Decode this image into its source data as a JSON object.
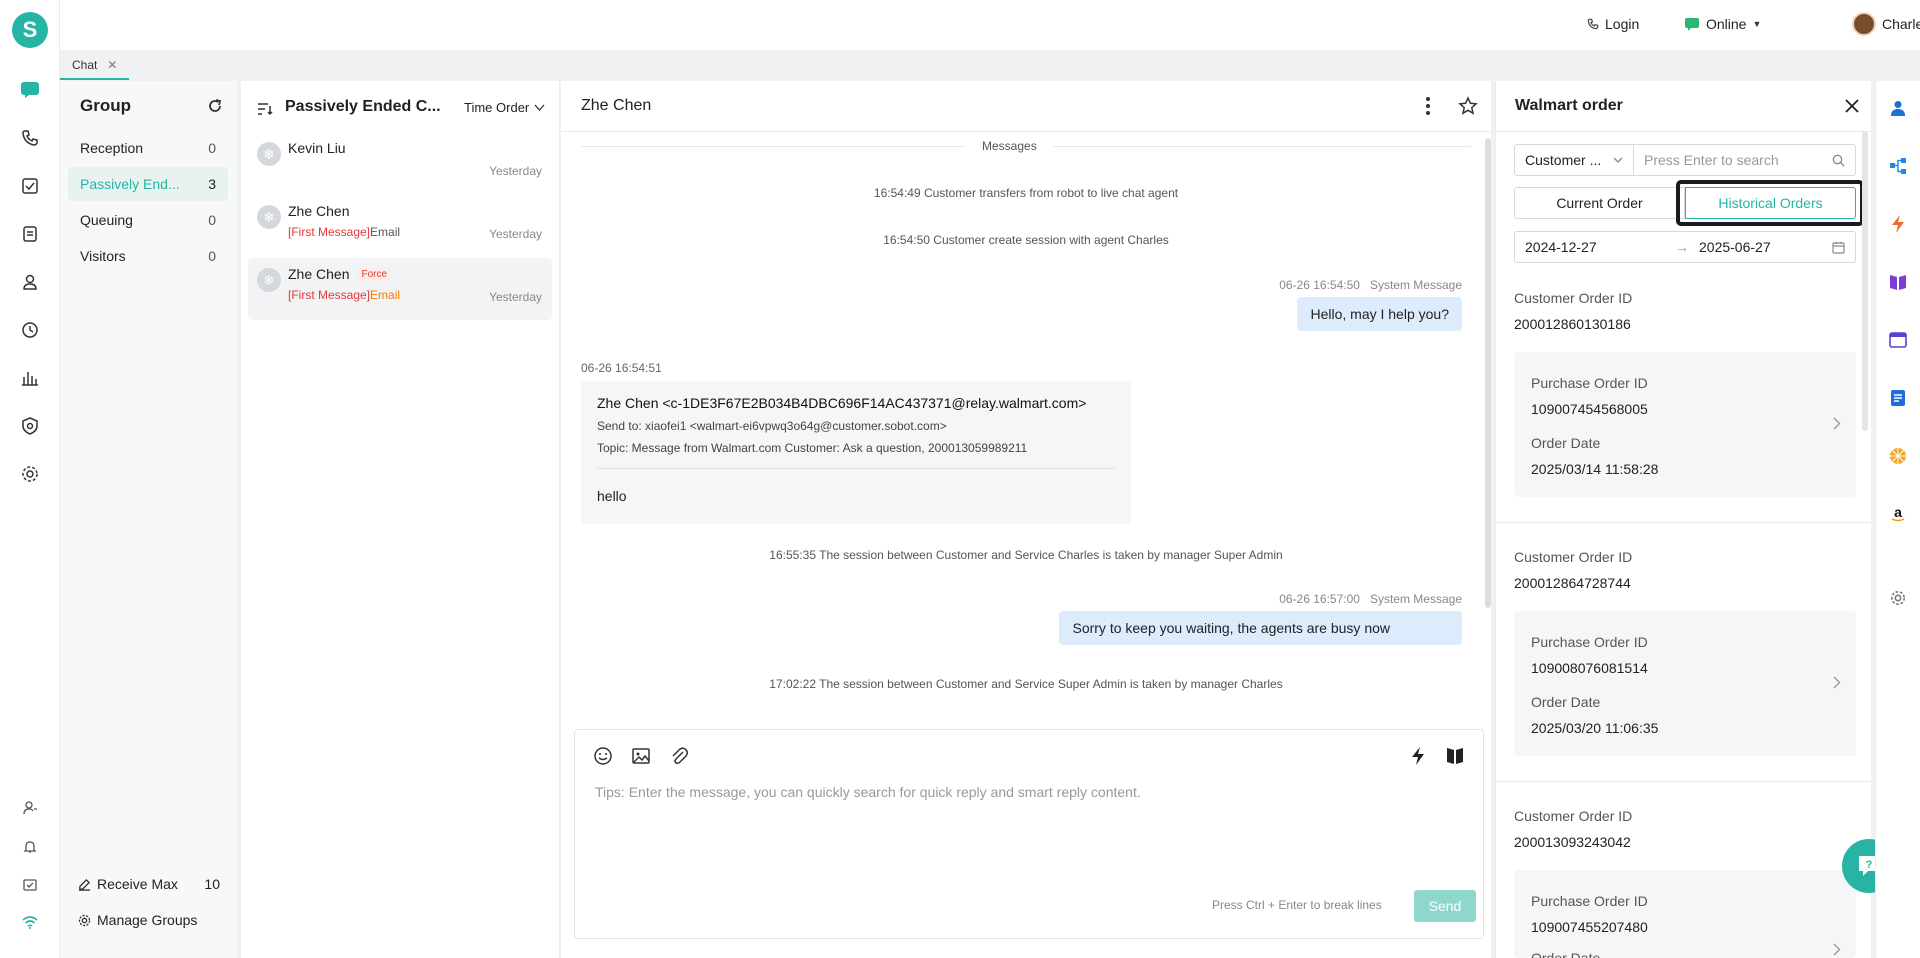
{
  "topbar": {
    "login": "Login",
    "status": "Online",
    "user": "Charles"
  },
  "tabs": [
    {
      "label": "Chat"
    }
  ],
  "groups": {
    "title": "Group",
    "items": [
      {
        "label": "Reception",
        "count": "0"
      },
      {
        "label": "Passively End...",
        "count": "3"
      },
      {
        "label": "Queuing",
        "count": "0"
      },
      {
        "label": "Visitors",
        "count": "0"
      }
    ],
    "receive_max_label": "Receive Max",
    "receive_max_value": "10",
    "manage_groups": "Manage Groups"
  },
  "list": {
    "title": "Passively Ended C...",
    "sort": "Time Order",
    "items": [
      {
        "name": "Kevin Liu",
        "tag": "",
        "preview_prefix": "",
        "preview_text": "",
        "time": "Yesterday"
      },
      {
        "name": "Zhe Chen",
        "tag": "",
        "preview_prefix": "[First Message]",
        "preview_text": "Email",
        "time": "Yesterday"
      },
      {
        "name": "Zhe Chen",
        "tag": "Force",
        "preview_prefix": "[First Message]",
        "preview_text": "Email",
        "time": "Yesterday"
      }
    ]
  },
  "chat": {
    "title": "Zhe Chen",
    "divider": "Messages",
    "sys1": "16:54:49 Customer transfers from robot to live chat agent",
    "sys2": "16:54:50 Customer create session with agent Charles",
    "msg1_time": "06-26 16:54:50",
    "msg1_sender": "System Message",
    "msg1_text": "Hello, may I help you?",
    "email_time": "06-26 16:54:51",
    "email_from": "Zhe Chen <c-1DE3F67E2B034B4DBC696F14AC437371@relay.walmart.com>",
    "email_to": "Send to: xiaofei1 <walmart-ei6vpwq3o64g@customer.sobot.com>",
    "email_topic": "Topic: Message from Walmart.com Customer:  Ask a question, 200013059989211",
    "email_body": "hello",
    "sys3": "16:55:35 The session between Customer and Service Charles is taken by manager Super Admin",
    "msg2_time": "06-26 16:57:00",
    "msg2_sender": "System Message",
    "msg2_text": "Sorry to keep you waiting, the agents are busy now",
    "sys4": "17:02:22 The session between Customer and Service Super Admin is taken by manager Charles",
    "input_placeholder": "Tips: Enter the message, you can quickly search for quick reply and smart reply content.",
    "hint": "Press Ctrl + Enter to break lines",
    "send": "Send"
  },
  "panel": {
    "title": "Walmart order",
    "search_type": "Customer ...",
    "search_placeholder": "Press Enter to search",
    "tab_current": "Current Order",
    "tab_history": "Historical Orders",
    "date_from": "2024-12-27",
    "date_to": "2025-06-27",
    "lbl_customer_order": "Customer Order ID",
    "lbl_purchase_order": "Purchase Order ID",
    "lbl_order_date": "Order Date",
    "orders": [
      {
        "customer_id": "200012860130186",
        "purchase_id": "109007454568005",
        "date": "2025/03/14 11:58:28"
      },
      {
        "customer_id": "200012864728744",
        "purchase_id": "109008076081514",
        "date": "2025/03/20 11:06:35"
      },
      {
        "customer_id": "200013093243042",
        "purchase_id": "109007455207480",
        "date": ""
      }
    ]
  },
  "colors": {
    "accent": "#27b4a4",
    "red": "#e53935",
    "orange": "#f57c00",
    "bubble": "#dcecfd",
    "highlight": "#1a1a1a"
  }
}
